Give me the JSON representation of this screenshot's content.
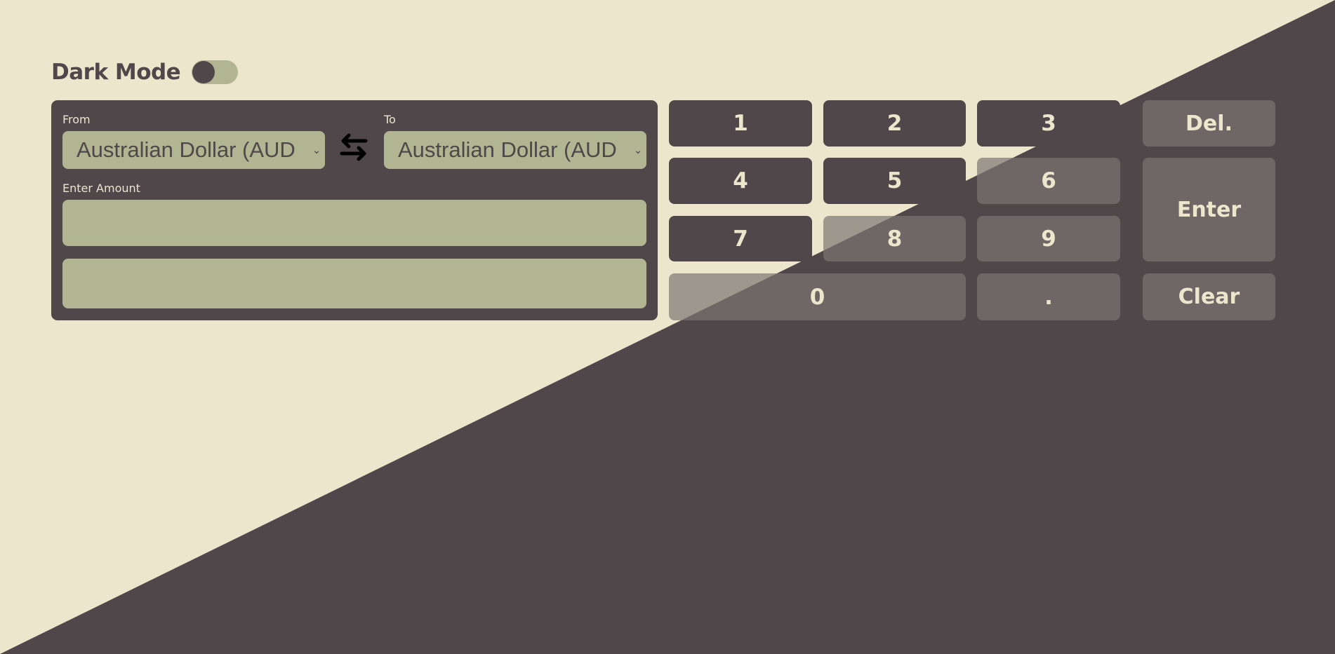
{
  "colors": {
    "background": "#ece6cd",
    "dark": "#4f474a",
    "accent": "#b2b591",
    "text_light": "#ece6cd"
  },
  "header": {
    "title": "Dark Mode"
  },
  "converter": {
    "from_label": "From",
    "to_label": "To",
    "from_value": "Australian Dollar (AUD",
    "to_value": "Australian Dollar (AUD",
    "amount_label": "Enter Amount",
    "amount_value": "",
    "result_value": ""
  },
  "keypad": {
    "k1": "1",
    "k2": "2",
    "k3": "3",
    "k4": "4",
    "k5": "5",
    "k6": "6",
    "k7": "7",
    "k8": "8",
    "k9": "9",
    "k0": "0",
    "kdot": ".",
    "del": "Del.",
    "enter": "Enter",
    "clear": "Clear"
  }
}
